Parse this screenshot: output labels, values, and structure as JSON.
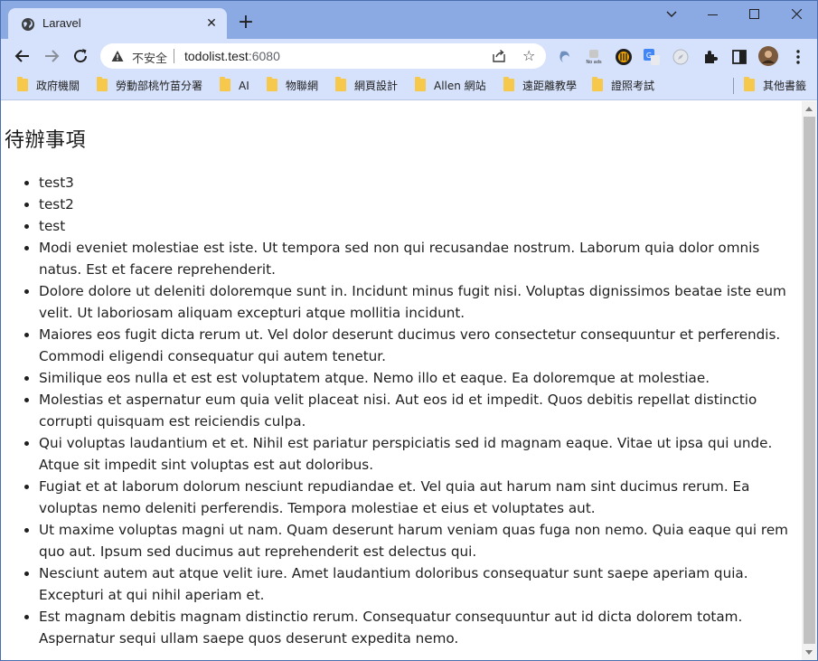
{
  "browser": {
    "tab": {
      "title": "Laravel",
      "close_glyph": "✕",
      "favicon": "globe-icon"
    },
    "new_tab_glyph": "+",
    "window_controls": {
      "dropdown": "⌄",
      "minimize": "—",
      "maximize": "☐",
      "close": "✕"
    },
    "omnibox": {
      "security_label": "不安全",
      "url_host": "todolist.test",
      "url_port": ":6080"
    },
    "bookmarks": [
      {
        "label": "政府機關"
      },
      {
        "label": "勞動部桃竹苗分署"
      },
      {
        "label": "AI"
      },
      {
        "label": "物聯網"
      },
      {
        "label": "網頁設計"
      },
      {
        "label": "Allen 網站"
      },
      {
        "label": "遠距離教學"
      },
      {
        "label": "證照考試"
      }
    ],
    "other_bookmarks": {
      "label": "其他書籤"
    },
    "accent": "#8ba9e2",
    "toolbar_bg": "#d6e2fb",
    "folder_color": "#f6c94d"
  },
  "page": {
    "heading": "待辦事項",
    "todos": [
      "test3",
      "test2",
      "test",
      "Modi eveniet molestiae est iste. Ut tempora sed non qui recusandae nostrum. Laborum quia dolor omnis natus. Est et facere reprehenderit.",
      "Dolore dolore ut deleniti doloremque sunt in. Incidunt minus fugit nisi. Voluptas dignissimos beatae iste eum velit. Ut laboriosam aliquam excepturi atque mollitia incidunt.",
      "Maiores eos fugit dicta rerum ut. Vel dolor deserunt ducimus vero consectetur consequuntur et perferendis. Commodi eligendi consequatur qui autem tenetur.",
      "Similique eos nulla et est est voluptatem atque. Nemo illo et eaque. Ea doloremque at molestiae.",
      "Molestias et aspernatur eum quia velit placeat nisi. Aut eos id et impedit. Quos debitis repellat distinctio corrupti quisquam est reiciendis culpa.",
      "Qui voluptas laudantium et et. Nihil est pariatur perspiciatis sed id magnam eaque. Vitae ut ipsa qui unde. Atque sit impedit sint voluptas est aut doloribus.",
      "Fugiat et at laborum dolorum nesciunt repudiandae et. Vel quia aut harum nam sint ducimus rerum. Ea voluptas nemo deleniti perferendis. Tempora molestiae et eius et voluptates aut.",
      "Ut maxime voluptas magni ut nam. Quam deserunt harum veniam quas fuga non nemo. Quia eaque qui rem quo aut. Ipsum sed ducimus aut reprehenderit est delectus qui.",
      "Nesciunt autem aut atque velit iure. Amet laudantium doloribus consequatur sunt saepe aperiam quia. Excepturi at qui nihil aperiam et.",
      "Est magnam debitis magnam distinctio rerum. Consequatur consequuntur aut id dicta dolorem totam. Aspernatur sequi ullam saepe quos deserunt expedita nemo."
    ]
  }
}
